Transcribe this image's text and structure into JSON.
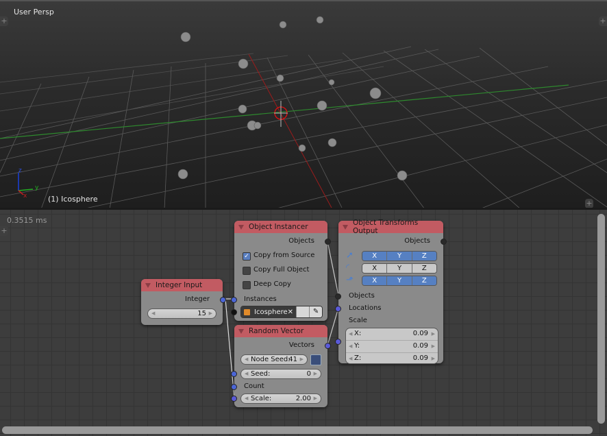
{
  "viewport": {
    "view_label": "User Persp",
    "object_label": "(1) Icosphere",
    "axes": {
      "x": "x",
      "y": "y",
      "z": "z"
    },
    "colors": {
      "x_axis": "#9b1c1c",
      "y_axis": "#2e8a2e",
      "cursor": "#e01010"
    }
  },
  "node_editor": {
    "timing": "0.3515 ms",
    "nodes": {
      "integer_input": {
        "title": "Integer Input",
        "output_label": "Integer",
        "value": "15"
      },
      "object_instancer": {
        "title": "Object Instancer",
        "output_label": "Objects",
        "options": [
          {
            "label": "Copy from Source",
            "checked": true
          },
          {
            "label": "Copy Full Object",
            "checked": false
          },
          {
            "label": "Deep Copy",
            "checked": false
          }
        ],
        "input_label": "Instances",
        "object_name": "Icosphere",
        "clear_glyph": "✕"
      },
      "random_vector": {
        "title": "Random Vector",
        "output_label": "Vectors",
        "node_seed_label": "Node Seed:",
        "node_seed_value": "41",
        "seed_label": "Seed:",
        "seed_value": "0",
        "count_label": "Count",
        "scale_label": "Scale:",
        "scale_value": "2.00"
      },
      "object_transforms_output": {
        "title": "Object Transforms Output",
        "output_label": "Objects",
        "toggle_rows": [
          {
            "icon": "location-icon",
            "axes": [
              "X",
              "Y",
              "Z"
            ],
            "active": true
          },
          {
            "icon": "rotation-icon",
            "axes": [
              "X",
              "Y",
              "Z"
            ],
            "active": false
          },
          {
            "icon": "scale-icon",
            "axes": [
              "X",
              "Y",
              "Z"
            ],
            "active": true
          }
        ],
        "inputs": [
          "Objects",
          "Locations",
          "Scale"
        ],
        "scale": [
          {
            "label": "X:",
            "value": "0.09"
          },
          {
            "label": "Y:",
            "value": "0.09"
          },
          {
            "label": "Z:",
            "value": "0.09"
          }
        ]
      }
    },
    "colors": {
      "header": "#c25b62",
      "node_body": "#8a8a8a",
      "vector_socket": "#5a5ad8",
      "object_socket": "#2a2a2a",
      "toggle_active": "#5680c2"
    }
  }
}
